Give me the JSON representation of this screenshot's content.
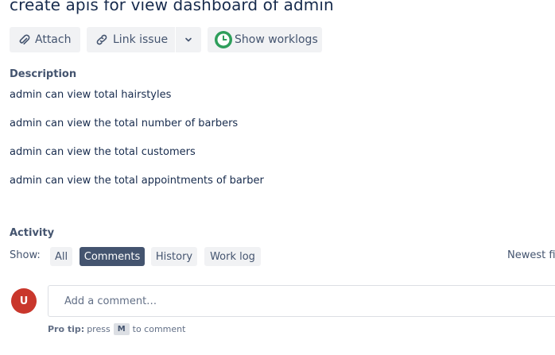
{
  "issue": {
    "title": "create apis for view dashboard of admin"
  },
  "toolbar": {
    "attach_label": "Attach",
    "link_issue_label": "Link issue",
    "worklogs_label": "Show worklogs",
    "worklog_icon_color": "#2e9e5b"
  },
  "description": {
    "heading": "Description",
    "lines": [
      "admin can view total hairstyles",
      "admin can view the total number of barbers",
      "admin can view the total customers",
      "admin can view the total appointments of barber"
    ]
  },
  "activity": {
    "heading": "Activity",
    "show_label": "Show:",
    "filters": [
      {
        "label": "All",
        "active": false
      },
      {
        "label": "Comments",
        "active": true
      },
      {
        "label": "History",
        "active": false
      },
      {
        "label": "Work log",
        "active": false
      }
    ],
    "sort_label": "Newest fi"
  },
  "comment": {
    "avatar_initial": "U",
    "avatar_color": "#c9372c",
    "placeholder": "Add a comment…",
    "tip_bold": "Pro tip:",
    "tip_press": "press",
    "tip_key": "M",
    "tip_suffix": "to comment"
  }
}
